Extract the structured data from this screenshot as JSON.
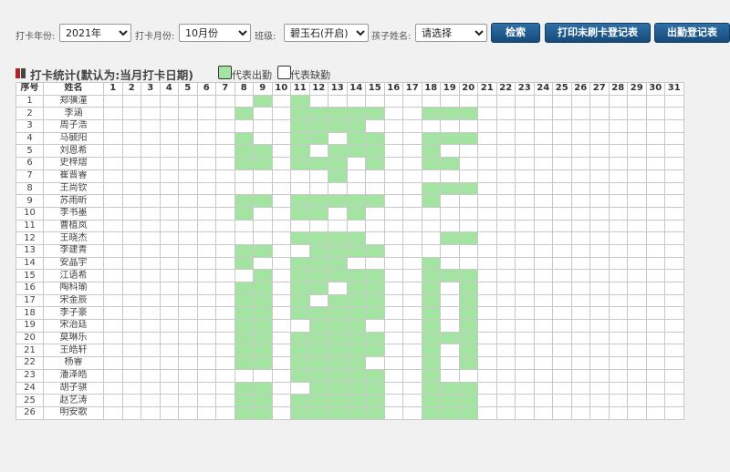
{
  "filters": {
    "year_label": "打卡年份:",
    "year_value": "2021年",
    "month_label": "打卡月份:",
    "month_value": "10月份",
    "class_label": "班级:",
    "class_value": "碧玉石(开启)",
    "child_label": "孩子姓名:",
    "child_value": "请选择"
  },
  "buttons": {
    "search": "检索",
    "print_unpunched": "打印未刷卡登记表",
    "attendance_register": "出勤登记表"
  },
  "section": {
    "title": "打卡统计(默认为:当月打卡日期)",
    "legend_present": "代表出勤",
    "legend_absent": "代表缺勤"
  },
  "colors": {
    "present": "#a3e4a3",
    "absent": "#ffffff",
    "button": "#1f5b8f",
    "title_mark": "#b22222"
  },
  "table": {
    "col_index": "序号",
    "col_name": "姓名",
    "days": [
      "1",
      "2",
      "3",
      "4",
      "5",
      "6",
      "7",
      "8",
      "9",
      "10",
      "11",
      "12",
      "13",
      "14",
      "15",
      "16",
      "17",
      "18",
      "19",
      "20",
      "21",
      "22",
      "23",
      "24",
      "25",
      "26",
      "27",
      "28",
      "29",
      "30",
      "31"
    ],
    "rows": [
      {
        "idx": "1",
        "name": "郑骥潼",
        "present": [
          9,
          11
        ]
      },
      {
        "idx": "2",
        "name": "李涵",
        "present": [
          8,
          11,
          12,
          13,
          14,
          15,
          18,
          19,
          20
        ]
      },
      {
        "idx": "3",
        "name": "周子浩",
        "present": [
          11,
          12,
          13,
          14
        ]
      },
      {
        "idx": "4",
        "name": "马毓阳",
        "present": [
          8,
          11,
          12,
          14,
          15,
          18,
          19,
          20
        ]
      },
      {
        "idx": "5",
        "name": "刘恩希",
        "present": [
          8,
          9,
          11,
          13,
          14,
          15,
          18
        ]
      },
      {
        "idx": "6",
        "name": "史梓熠",
        "present": [
          8,
          9,
          11,
          12,
          13,
          15,
          18,
          19
        ]
      },
      {
        "idx": "7",
        "name": "崔晋睿",
        "present": [
          13
        ]
      },
      {
        "idx": "8",
        "name": "王尚钦",
        "present": [
          18,
          19,
          20
        ]
      },
      {
        "idx": "9",
        "name": "苏雨昕",
        "present": [
          8,
          9,
          11,
          12,
          13,
          14,
          15,
          18
        ]
      },
      {
        "idx": "10",
        "name": "李书墨",
        "present": [
          8,
          11,
          12,
          14
        ]
      },
      {
        "idx": "11",
        "name": "曹植岚",
        "present": []
      },
      {
        "idx": "12",
        "name": "王晓杰",
        "present": [
          11,
          12,
          13,
          14,
          19,
          20
        ]
      },
      {
        "idx": "13",
        "name": "李建青",
        "present": [
          8,
          9,
          12,
          13,
          14,
          15
        ]
      },
      {
        "idx": "14",
        "name": "安晶宇",
        "present": [
          8,
          11,
          12,
          13,
          18
        ]
      },
      {
        "idx": "15",
        "name": "江语希",
        "present": [
          9,
          11,
          12,
          13,
          14,
          15,
          18,
          19,
          20
        ]
      },
      {
        "idx": "16",
        "name": "陶科瑜",
        "present": [
          8,
          9,
          11,
          12,
          14,
          15,
          18,
          20
        ]
      },
      {
        "idx": "17",
        "name": "宋金辰",
        "present": [
          8,
          9,
          11,
          13,
          14,
          15,
          18,
          20
        ]
      },
      {
        "idx": "18",
        "name": "李子豪",
        "present": [
          8,
          9,
          11,
          12,
          13,
          14,
          15,
          18,
          20
        ]
      },
      {
        "idx": "19",
        "name": "宋治廷",
        "present": [
          8,
          9,
          12,
          13,
          14,
          18,
          20
        ]
      },
      {
        "idx": "20",
        "name": "莫琳乐",
        "present": [
          8,
          9,
          11,
          12,
          13,
          14,
          15,
          18,
          19,
          20
        ]
      },
      {
        "idx": "21",
        "name": "王皓轩",
        "present": [
          8,
          9,
          11,
          12,
          13,
          14,
          15,
          18,
          20
        ]
      },
      {
        "idx": "22",
        "name": "杨睿",
        "present": [
          8,
          9,
          11,
          12,
          13,
          14,
          18,
          20
        ]
      },
      {
        "idx": "23",
        "name": "潘泽皓",
        "present": [
          11,
          12,
          13,
          14,
          15,
          18
        ]
      },
      {
        "idx": "24",
        "name": "胡子骐",
        "present": [
          8,
          9,
          12,
          13,
          14,
          15,
          18,
          19,
          20
        ]
      },
      {
        "idx": "25",
        "name": "赵艺涛",
        "present": [
          8,
          9,
          11,
          12,
          13,
          14,
          15,
          18,
          19,
          20
        ]
      },
      {
        "idx": "26",
        "name": "明安歌",
        "present": [
          8,
          9,
          11,
          12,
          13,
          14,
          15,
          18,
          19,
          20
        ]
      }
    ]
  }
}
